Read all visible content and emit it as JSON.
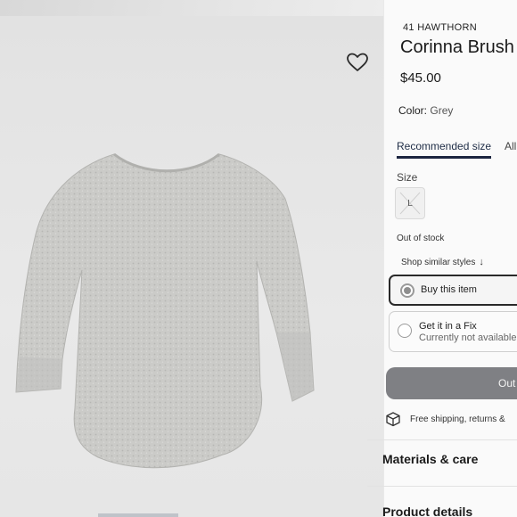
{
  "product": {
    "brand": "41 HAWTHORN",
    "title": "Corinna Brush",
    "price": "$45.00",
    "color_label": "Color:",
    "color_value": "Grey"
  },
  "size_tabs": [
    "Recommended size",
    "All"
  ],
  "size": {
    "label": "Size",
    "selected": "L",
    "status": "Out of stock"
  },
  "shop_similar": "Shop similar styles",
  "purchase_options": [
    {
      "label": "Buy this item",
      "sublabel": "",
      "selected": true
    },
    {
      "label": "Get it in a Fix",
      "sublabel": "Currently not available",
      "selected": false
    }
  ],
  "cta_label": "Out",
  "shipping_text": "Free shipping, returns &",
  "sections": [
    "Materials & care",
    "Product details"
  ],
  "icons": {
    "favorite": "heart-icon",
    "shipping": "box-icon",
    "shop_similar": "arrow-down-icon"
  },
  "colors": {
    "accent": "#1c2540",
    "cta_bg": "#7f8084",
    "garment": "#c9c9c6"
  }
}
